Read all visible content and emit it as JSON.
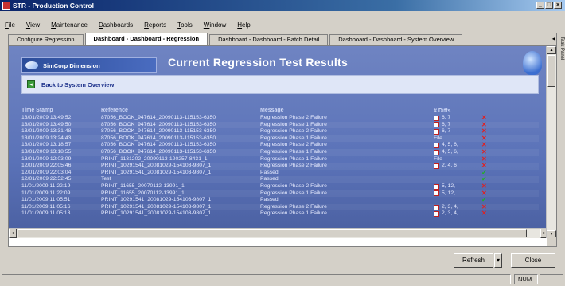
{
  "window": {
    "title": "STR - Production Control"
  },
  "menu": [
    "File",
    "View",
    "Maintenance",
    "Dashboards",
    "Reports",
    "Tools",
    "Window",
    "Help"
  ],
  "tabs": [
    {
      "label": "Configure Regression",
      "active": false
    },
    {
      "label": "Dashboard - Dashboard - Regression",
      "active": true
    },
    {
      "label": "Dashboard - Dashboard - Batch Detail",
      "active": false
    },
    {
      "label": "Dashboard - Dashboard - System Overview",
      "active": false
    }
  ],
  "tab_nav": "◂ ▸",
  "header": {
    "logo_text": "SimCorp Dimension",
    "title": "Current Regression Test Results",
    "back_link": "Back to System Overview"
  },
  "table": {
    "columns": [
      "Time Stamp",
      "Reference",
      "Message",
      "# Diffs"
    ],
    "rows": [
      {
        "ts": "13/01/2009 13:49:52",
        "ref": "87056_BOOK_947614_20090113-115153-6350",
        "msg": "Regression Phase 2 Failure",
        "diffs": "6, 7",
        "doc": true,
        "status": "fail"
      },
      {
        "ts": "13/01/2009 13:49:50",
        "ref": "87056_BOOK_947614_20090113-115153-6350",
        "msg": "Regression Phase 1 Failure",
        "diffs": "6, 7",
        "doc": true,
        "status": "fail"
      },
      {
        "ts": "13/01/2009 13:31:48",
        "ref": "87056_BOOK_947614_20090113-115153-6350",
        "msg": "Regression Phase 2 Failure",
        "diffs": "6, 7",
        "doc": true,
        "status": "fail"
      },
      {
        "ts": "13/01/2009 13:24:43",
        "ref": "87056_BOOK_947614_20090113-115153-6350",
        "msg": "Regression Phase 1 Failure",
        "diffs": "File",
        "doc": false,
        "status": "fail"
      },
      {
        "ts": "13/01/2009 13:18:57",
        "ref": "87056_BOOK_947614_20090113-115153-6350",
        "msg": "Regression Phase 2 Failure",
        "diffs": "4, 5, 6,",
        "doc": true,
        "status": "fail"
      },
      {
        "ts": "13/01/2009 13:18:55",
        "ref": "87056_BOOK_947614_20090113-115153-6350",
        "msg": "Regression Phase 1 Failure",
        "diffs": "4, 5, 6,",
        "doc": true,
        "status": "fail"
      },
      {
        "ts": "13/01/2009 12:03:09",
        "ref": "PRINT_1131202_20090113-120257-8431_1",
        "msg": "Regression Phase 1 Failure",
        "diffs": "File",
        "doc": false,
        "status": "fail"
      },
      {
        "ts": "12/01/2009 22:05:46",
        "ref": "PRINT_10291541_20081029-154103-9807_1",
        "msg": "Regression Phase 2 Failure",
        "diffs": "2, 4, 6",
        "doc": true,
        "status": "fail"
      },
      {
        "ts": "12/01/2009 22:03:04",
        "ref": "PRINT_10291541_20081029-154103-9807_1",
        "msg": "Passed",
        "diffs": "",
        "doc": false,
        "status": "pass"
      },
      {
        "ts": "12/01/2009 22:52:45",
        "ref": "Test",
        "msg": "Passed",
        "diffs": "",
        "doc": false,
        "status": "pass"
      },
      {
        "ts": "11/01/2009 11:22:19",
        "ref": "PRINT_11655_20070112-13991_1",
        "msg": "Regression Phase 2 Failure",
        "diffs": "5, 12,",
        "doc": true,
        "status": "fail"
      },
      {
        "ts": "11/01/2009 11:22:09",
        "ref": "PRINT_11655_20070112-13991_1",
        "msg": "Regression Phase 1 Failure",
        "diffs": "5, 12,",
        "doc": true,
        "status": "fail"
      },
      {
        "ts": "11/01/2009 11:05:51",
        "ref": "PRINT_10291541_20081029-154103-9807_1",
        "msg": "Passed",
        "diffs": "",
        "doc": false,
        "status": "pass"
      },
      {
        "ts": "11/01/2009 11:05:16",
        "ref": "PRINT_10291541_20081029-154103-9807_1",
        "msg": "Regression Phase 2 Failure",
        "diffs": "2, 3, 4,",
        "doc": true,
        "status": "fail"
      },
      {
        "ts": "11/01/2009 11:05:13",
        "ref": "PRINT_10291541_20081029-154103-9807_1",
        "msg": "Regression Phase 1 Failure",
        "diffs": "2, 3, 4,",
        "doc": true,
        "status": "fail"
      }
    ]
  },
  "buttons": {
    "refresh": "Refresh",
    "dropdown": "▾",
    "close": "Close"
  },
  "statusbar": {
    "num": "NUM"
  },
  "side_label": "Task Panel"
}
